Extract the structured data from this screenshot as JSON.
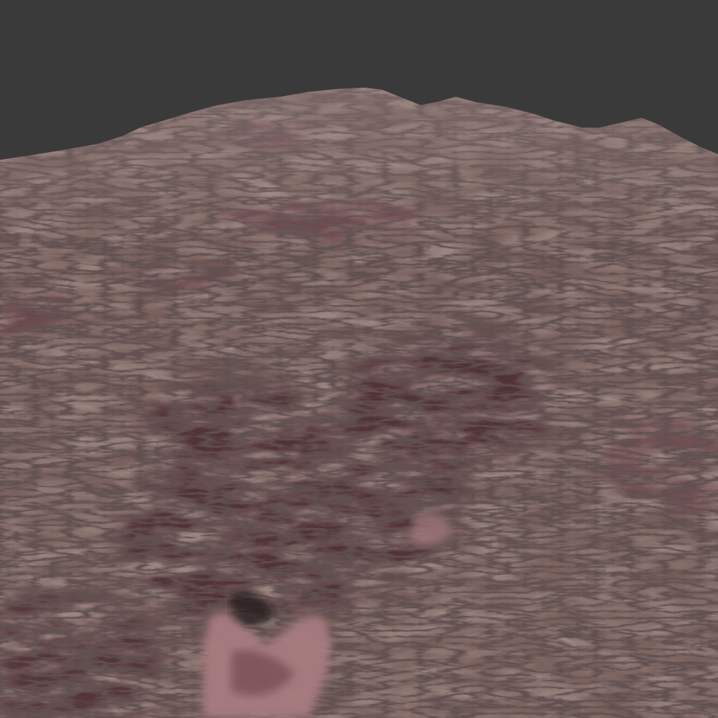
{
  "scene": {
    "subject": "terrain-render",
    "colors": {
      "sky": "#3a3a3a",
      "rock_light": "#9a8580",
      "rock_mid": "#7a625e",
      "rock_dark": "#3e2b2b",
      "basin_dark": "#4a2a30",
      "basin_mid": "#6b4048",
      "basin_light": "#a87c80",
      "shadow": "#1e1616"
    }
  }
}
